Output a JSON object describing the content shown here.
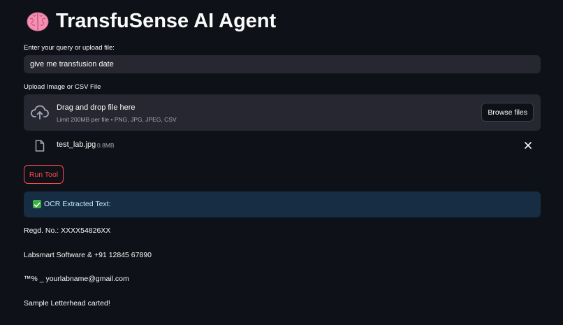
{
  "app": {
    "title": "TransfuSense AI Agent",
    "brain_icon": "brain-icon"
  },
  "query": {
    "label": "Enter your query or upload file:",
    "value": "give me transfusion date"
  },
  "upload": {
    "label": "Upload Image or CSV File",
    "drop_text": "Drag and drop file here",
    "limit_text": "Limit 200MB per file • PNG, JPG, JPEG, CSV",
    "browse_label": "Browse files",
    "upload_icon": "cloud-upload-icon"
  },
  "file": {
    "name": "test_lab.jpg",
    "size": "0.8MB",
    "file_icon": "file-icon",
    "close_icon": "close-icon"
  },
  "run_button": {
    "label": "Run Tool"
  },
  "ocr": {
    "label": "OCR Extracted Text:",
    "check_icon": "check-icon",
    "lines": [
      "Regd. No.: XXXX54826XX",
      "Labsmart Software & +91 12845 67890",
      "™% _ yourlabname@gmail.com",
      "Sample Letterhead carted!"
    ]
  },
  "colors": {
    "background": "#0e1117",
    "input_bg": "#262730",
    "accent": "#ff4b4b",
    "info_bg": "#172d43",
    "info_text": "#c7ebff",
    "check": "#3cb043"
  }
}
